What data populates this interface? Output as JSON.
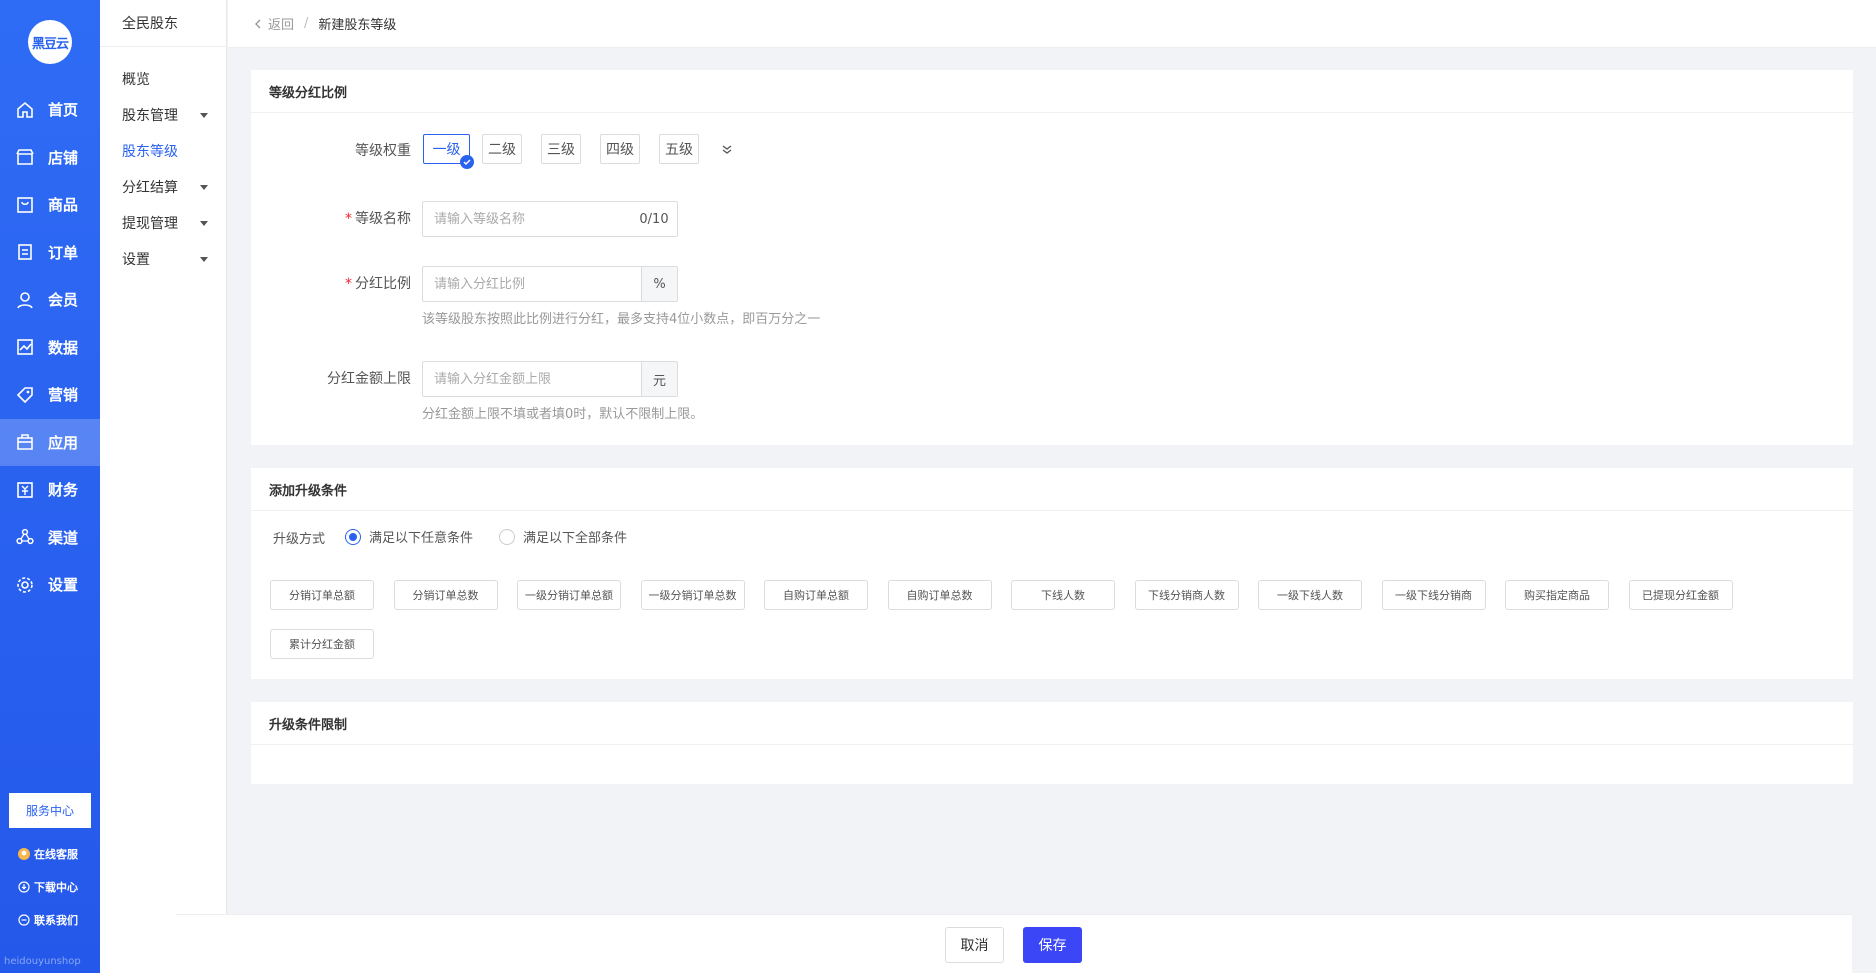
{
  "brand": {
    "logo_text": "黑豆云",
    "watermark": "heidouyunshop"
  },
  "rail": {
    "items": [
      {
        "label": "首页",
        "icon": "home-icon"
      },
      {
        "label": "店铺",
        "icon": "store-icon"
      },
      {
        "label": "商品",
        "icon": "goods-icon"
      },
      {
        "label": "订单",
        "icon": "order-icon"
      },
      {
        "label": "会员",
        "icon": "member-icon"
      },
      {
        "label": "数据",
        "icon": "chart-icon"
      },
      {
        "label": "营销",
        "icon": "tag-icon"
      },
      {
        "label": "应用",
        "icon": "app-icon"
      },
      {
        "label": "财务",
        "icon": "finance-icon"
      },
      {
        "label": "渠道",
        "icon": "channel-icon"
      },
      {
        "label": "设置",
        "icon": "gear-icon"
      }
    ],
    "active_index": 7,
    "service_center": "服务中心",
    "links": [
      "在线客服",
      "下载中心",
      "联系我们"
    ]
  },
  "subside": {
    "title": "全民股东",
    "items": [
      {
        "label": "概览",
        "caret": false
      },
      {
        "label": "股东管理",
        "caret": true
      },
      {
        "label": "股东等级",
        "caret": false
      },
      {
        "label": "分红结算",
        "caret": true
      },
      {
        "label": "提现管理",
        "caret": true
      },
      {
        "label": "设置",
        "caret": true
      }
    ],
    "active_index": 2
  },
  "breadcrumb": {
    "back": "返回",
    "separator": "/",
    "current": "新建股东等级"
  },
  "section1": {
    "title": "等级分红比例",
    "weight_label": "等级权重",
    "levels": [
      "一级",
      "二级",
      "三级",
      "四级",
      "五级"
    ],
    "selected_level": 0,
    "name_label": "等级名称",
    "name_placeholder": "请输入等级名称",
    "name_counter": "0/10",
    "ratio_label": "分红比例",
    "ratio_placeholder": "请输入分红比例",
    "ratio_suffix": "%",
    "ratio_help": "该等级股东按照此比例进行分红，最多支持4位小数点，即百万分之一",
    "limit_label": "分红金额上限",
    "limit_placeholder": "请输入分红金额上限",
    "limit_suffix": "元",
    "limit_help": "分红金额上限不填或者填0时，默认不限制上限。"
  },
  "section2": {
    "title": "添加升级条件",
    "mode_label": "升级方式",
    "mode_any": "满足以下任意条件",
    "mode_all": "满足以下全部条件",
    "conditions": [
      "分销订单总额",
      "分销订单总数",
      "一级分销订单总额",
      "一级分销订单总数",
      "自购订单总额",
      "自购订单总数",
      "下线人数",
      "下线分销商人数",
      "一级下线人数",
      "一级下线分销商",
      "购买指定商品",
      "已提现分红金额",
      "累计分红金额"
    ]
  },
  "section3": {
    "title": "升级条件限制"
  },
  "footer": {
    "cancel": "取消",
    "save": "保存"
  },
  "colors": {
    "primary": "#2a62f0",
    "save_button": "#3b46f6",
    "required": "#f5222d"
  }
}
